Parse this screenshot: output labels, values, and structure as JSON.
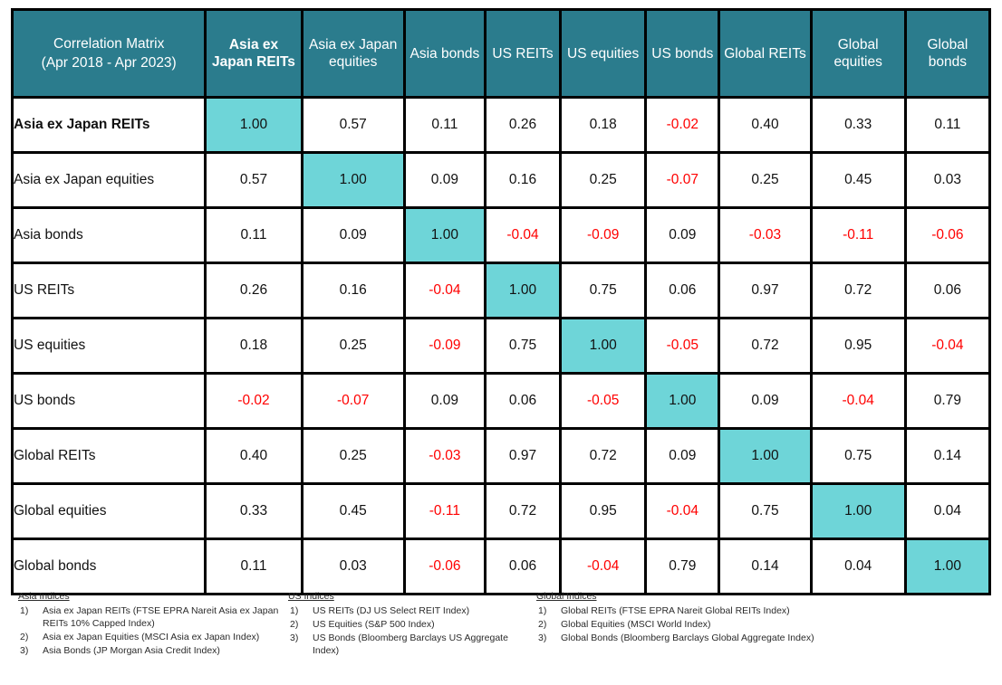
{
  "table": {
    "corner_title_line1": "Correlation Matrix",
    "corner_title_line2": "(Apr 2018 - Apr 2023)",
    "column_headers": [
      "Asia ex Japan REITs",
      "Asia ex Japan equities",
      "Asia bonds",
      "US REITs",
      "US equities",
      "US bonds",
      "Global REITs",
      "Global equities",
      "Global bonds"
    ],
    "row_labels": [
      "Asia ex Japan REITs",
      "Asia ex Japan equities",
      "Asia bonds",
      "US REITs",
      "US equities",
      "US bonds",
      "Global REITs",
      "Global equities",
      "Global bonds"
    ]
  },
  "colors": {
    "header_teal": "#2b7c8d",
    "diagonal_cyan": "#6ed5d8",
    "negative_red": "#ff0000",
    "grid_black": "#000000",
    "cell_white": "#ffffff"
  },
  "chart_data": {
    "type": "heatmap",
    "title": "Correlation Matrix (Apr 2018 - Apr 2023)",
    "xlabel": "",
    "ylabel": "",
    "categories": [
      "Asia ex Japan REITs",
      "Asia ex Japan equities",
      "Asia bonds",
      "US REITs",
      "US equities",
      "US bonds",
      "Global REITs",
      "Global equities",
      "Global bonds"
    ],
    "matrix": [
      [
        "1.00",
        "0.57",
        "0.11",
        "0.26",
        "0.18",
        "-0.02",
        "0.40",
        "0.33",
        "0.11"
      ],
      [
        "0.57",
        "1.00",
        "0.09",
        "0.16",
        "0.25",
        "-0.07",
        "0.25",
        "0.45",
        "0.03"
      ],
      [
        "0.11",
        "0.09",
        "1.00",
        "-0.04",
        "-0.09",
        "0.09",
        "-0.03",
        "-0.11",
        "-0.06"
      ],
      [
        "0.26",
        "0.16",
        "-0.04",
        "1.00",
        "0.75",
        "0.06",
        "0.97",
        "0.72",
        "0.06"
      ],
      [
        "0.18",
        "0.25",
        "-0.09",
        "0.75",
        "1.00",
        "-0.05",
        "0.72",
        "0.95",
        "-0.04"
      ],
      [
        "-0.02",
        "-0.07",
        "0.09",
        "0.06",
        "-0.05",
        "1.00",
        "0.09",
        "-0.04",
        "0.79"
      ],
      [
        "0.40",
        "0.25",
        "-0.03",
        "0.97",
        "0.72",
        "0.09",
        "1.00",
        "0.75",
        "0.14"
      ],
      [
        "0.33",
        "0.45",
        "-0.11",
        "0.72",
        "0.95",
        "-0.04",
        "0.75",
        "1.00",
        "0.04"
      ],
      [
        "0.11",
        "0.03",
        "-0.06",
        "0.06",
        "-0.04",
        "0.79",
        "0.14",
        "0.04",
        "1.00"
      ]
    ],
    "period": "Apr 2018 - Apr 2023",
    "legend": "Diagonal (self-correlation = 1.00) highlighted in cyan; negative values shown in red",
    "grid": true
  },
  "notes": {
    "asia": {
      "title": "Asia Indices",
      "items": [
        "Asia ex Japan REITs (FTSE EPRA Nareit Asia ex Japan REITs 10% Capped Index)",
        "Asia ex Japan Equities (MSCI Asia ex Japan Index)",
        "Asia Bonds (JP Morgan Asia Credit Index)"
      ],
      "numbers": [
        "1)",
        "2)",
        "3)"
      ]
    },
    "us": {
      "title": "US Indices",
      "items": [
        "US REITs (DJ US Select REIT Index)",
        "US Equities (S&P 500 Index)",
        "US Bonds (Bloomberg Barclays US Aggregate Index)"
      ],
      "numbers": [
        "1)",
        "2)",
        "3)"
      ]
    },
    "global": {
      "title": "Global Indices",
      "items": [
        "Global REITs (FTSE EPRA Nareit Global REITs Index)",
        "Global Equities (MSCI World Index)",
        "Global Bonds (Bloomberg Barclays Global Aggregate Index)"
      ],
      "numbers": [
        "1)",
        "2)",
        "3)"
      ]
    }
  }
}
